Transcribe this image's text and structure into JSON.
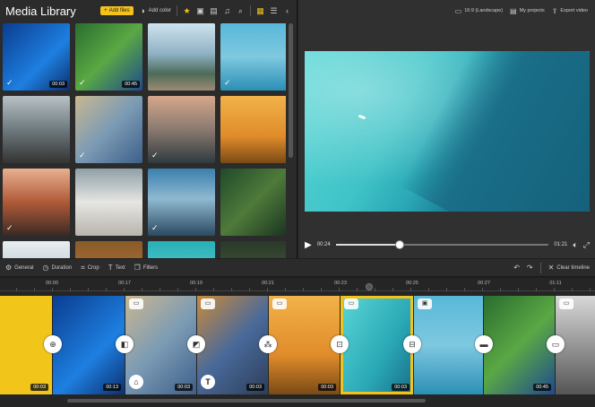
{
  "media_panel": {
    "title": "Media Library",
    "add_files_label": "Add files",
    "add_color_label": "Add color",
    "thumbnails": [
      {
        "name": "windows-blue",
        "bg": "linear-gradient(135deg,#0a3d91,#1e7fe0 60%,#0c2f6e)",
        "checked": true,
        "duration": "00:03"
      },
      {
        "name": "parrot",
        "bg": "linear-gradient(135deg,#2a6d2f,#5aa844 50%,#1f4a8c)",
        "checked": true,
        "duration": "00:45"
      },
      {
        "name": "rio-city",
        "bg": "linear-gradient(180deg,#cfe3ef,#8fb2c4 45%,#4d6b58 75%,#9c8b74)",
        "checked": false,
        "duration": ""
      },
      {
        "name": "woman-pool",
        "bg": "linear-gradient(180deg,#58b8d8,#7ec8e0 50%,#2c8fb5)",
        "checked": true,
        "duration": ""
      },
      {
        "name": "woman-mountains",
        "bg": "linear-gradient(180deg,#b8c2c6,#6f7a7e 50%,#333)",
        "checked": false,
        "duration": ""
      },
      {
        "name": "travel-map",
        "bg": "linear-gradient(135deg,#c9b790,#7c9bb5 50%,#3d5f8a)",
        "checked": true,
        "duration": ""
      },
      {
        "name": "jeep-sunset",
        "bg": "linear-gradient(180deg,#d6a78a,#8a7a70 50%,#2f3a3e)",
        "checked": true,
        "duration": ""
      },
      {
        "name": "temples",
        "bg": "linear-gradient(180deg,#f2b24a,#e08c2a 60%,#7a4a16)",
        "checked": false,
        "duration": ""
      },
      {
        "name": "desert-road",
        "bg": "linear-gradient(180deg,#e8b090,#b05a38 50%,#3a2a24)",
        "checked": true,
        "duration": ""
      },
      {
        "name": "santorini",
        "bg": "linear-gradient(180deg,#8fa0a8,#e6e6e2 50%,#b8b4ae)",
        "checked": false,
        "duration": ""
      },
      {
        "name": "lake-hiker",
        "bg": "linear-gradient(180deg,#3b7fb0,#8fb9d0 45%,#2a4a60)",
        "checked": true,
        "duration": ""
      },
      {
        "name": "forest-road",
        "bg": "linear-gradient(135deg,#1f4a2a,#4f7a3a 50%,#1a3320)",
        "checked": false,
        "duration": ""
      },
      {
        "name": "snow-mountains",
        "bg": "linear-gradient(180deg,#e8eef2,#9aa8b2)",
        "checked": false,
        "duration": ""
      },
      {
        "name": "food",
        "bg": "linear-gradient(180deg,#8a5a2a,#c8873f)",
        "checked": false,
        "duration": ""
      },
      {
        "name": "beach-top",
        "bg": "linear-gradient(180deg,#27b0b8,#7fd8d0)",
        "checked": false,
        "duration": ""
      },
      {
        "name": "dark-forest",
        "bg": "linear-gradient(180deg,#2a3a2a,#556a44)",
        "checked": false,
        "duration": ""
      }
    ]
  },
  "preview": {
    "aspect_label": "16:9 (Landscape)",
    "projects_label": "My projects",
    "export_label": "Export video",
    "current_time": "00:24",
    "total_time": "01:21",
    "progress": 0.3
  },
  "toolbar": {
    "items": [
      {
        "name": "general",
        "icon": "⚙",
        "label": "General"
      },
      {
        "name": "duration",
        "icon": "◷",
        "label": "Duration"
      },
      {
        "name": "crop",
        "icon": "⌗",
        "label": "Crop"
      },
      {
        "name": "text",
        "icon": "T",
        "label": "Text"
      },
      {
        "name": "filters",
        "icon": "❐",
        "label": "Filters"
      }
    ],
    "clear_label": "Clear timeline"
  },
  "timeline": {
    "ticks": [
      "00:00",
      "00:17",
      "00:19",
      "00:21",
      "00:23",
      "00:25",
      "00:27",
      "01:11"
    ],
    "clips": [
      {
        "name": "yellow-color",
        "bg": "#f2c51b",
        "duration": "00:03"
      },
      {
        "name": "windows-blue",
        "bg": "linear-gradient(135deg,#0a3d91,#1e7fe0 60%,#0c2f6e)",
        "duration": "00:13"
      },
      {
        "name": "travel-map",
        "bg": "linear-gradient(135deg,#c9b790,#7c9bb5 50%,#3d5f8a)",
        "duration": "00:03"
      },
      {
        "name": "window-road",
        "bg": "linear-gradient(135deg,#c98a3a,#4a6a9a 50%,#2c3e5a)",
        "duration": "00:03"
      },
      {
        "name": "temples",
        "bg": "linear-gradient(180deg,#f2b24a,#e08c2a 60%,#7a4a16)",
        "duration": "00:03"
      },
      {
        "name": "beach-aerial",
        "bg": "linear-gradient(120deg,#5ad7d6,#2aa8b5 60%,#186d87)",
        "duration": "00:03"
      },
      {
        "name": "woman-pool",
        "bg": "linear-gradient(180deg,#58b8d8,#7ec8e0 50%,#2c8fb5)",
        "duration": ""
      },
      {
        "name": "parrot",
        "bg": "linear-gradient(135deg,#2a6d2f,#5aa844 50%,#1f4a8c)",
        "duration": "00:45"
      },
      {
        "name": "laptop",
        "bg": "linear-gradient(180deg,#d8d8d8,#555)",
        "duration": ""
      }
    ]
  }
}
